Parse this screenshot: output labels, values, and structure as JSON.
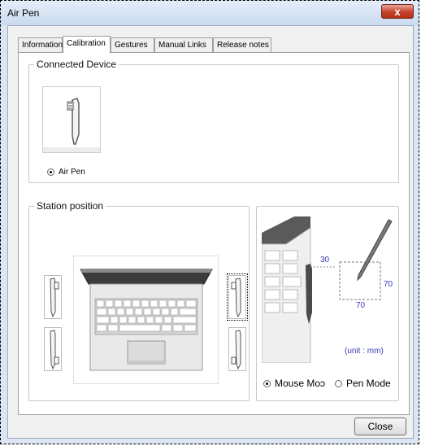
{
  "window": {
    "title": "Air Pen",
    "close_glyph": "x"
  },
  "tabs": [
    {
      "label": "Information",
      "active": false
    },
    {
      "label": "Calibration",
      "active": true
    },
    {
      "label": "Gestures",
      "active": false
    },
    {
      "label": "Manual Links",
      "active": false
    },
    {
      "label": "Release notes",
      "active": false
    }
  ],
  "connected_device": {
    "legend": "Connected Device",
    "device_icon": "air-pen-icon",
    "radio_label": "Air Pen",
    "radio_checked": true
  },
  "station_position": {
    "legend": "Station position",
    "positions": [
      "left-top",
      "left-bottom",
      "right-top",
      "right-bottom"
    ],
    "selected_position": "right-top"
  },
  "mode_panel": {
    "dimension_x": "30",
    "dimension_width": "70",
    "dimension_height": "70",
    "unit_label": "(unit : mm)",
    "mouse_mode_label": "Mouse Moɔ",
    "pen_mode_label": "Pen Mode",
    "selected_mode": "mouse"
  },
  "footer": {
    "close_label": "Close"
  }
}
